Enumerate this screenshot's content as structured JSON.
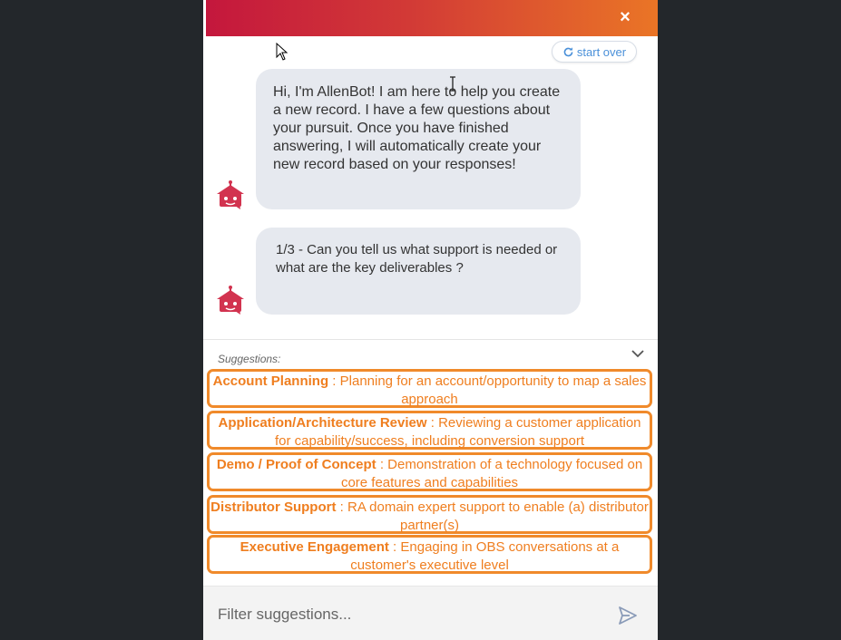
{
  "header": {
    "close_label": "×"
  },
  "start_over": {
    "label": "start over",
    "icon": "refresh-icon"
  },
  "messages": [
    {
      "text": "Hi, I'm AllenBot! I am here to help you create a new record. I have a few questions about your pursuit. Once you have finished answering, I will automatically create your new record based on your responses!",
      "avatar_icon": "bot-avatar-icon"
    },
    {
      "text": "1/3 - Can you tell us what support is needed or what are the key deliverables ?",
      "avatar_icon": "bot-avatar-icon"
    }
  ],
  "suggestions_label": "Suggestions:",
  "suggestions": [
    {
      "title": "Account Planning",
      "desc": "Planning for an account/opportunity to map a sales approach"
    },
    {
      "title": "Application/Architecture Review",
      "desc": "Reviewing a customer application for capability/success, including conversion support"
    },
    {
      "title": "Demo / Proof of Concept",
      "desc": "Demonstration of a technology focused on core features and capabilities"
    },
    {
      "title": "Distributor Support",
      "desc": "RA domain expert support to enable (a) distributor partner(s)"
    },
    {
      "title": "Executive Engagement",
      "desc": "Engaging in OBS conversations at a customer's executive level"
    }
  ],
  "separator": " : ",
  "filter": {
    "placeholder": "Filter suggestions...",
    "value": ""
  },
  "colors": {
    "header_start": "#c4173d",
    "header_end": "#ea7526",
    "accent": "#f08a2b",
    "bot": "#d2334f",
    "link": "#4a90d9"
  }
}
